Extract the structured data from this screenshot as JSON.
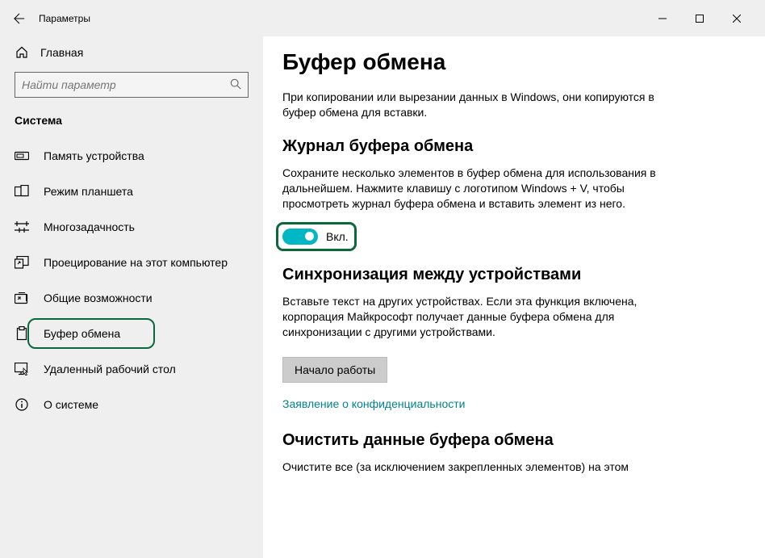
{
  "window": {
    "title": "Параметры"
  },
  "sidebar": {
    "home": "Главная",
    "search_placeholder": "Найти параметр",
    "category": "Система",
    "items": [
      {
        "label": "Память устройства"
      },
      {
        "label": "Режим планшета"
      },
      {
        "label": "Многозадачность"
      },
      {
        "label": "Проецирование на этот компьютер"
      },
      {
        "label": "Общие возможности"
      },
      {
        "label": "Буфер обмена"
      },
      {
        "label": "Удаленный рабочий стол"
      },
      {
        "label": "О системе"
      }
    ]
  },
  "page": {
    "title": "Буфер обмена",
    "intro": "При копировании или вырезании данных в Windows, они копируются в буфер обмена для вставки.",
    "history": {
      "title": "Журнал буфера обмена",
      "description": "Сохраните несколько элементов в буфер обмена для использования в дальнейшем. Нажмите клавишу с логотипом Windows + V, чтобы просмотреть журнал буфера обмена и вставить элемент из него.",
      "toggle_state": "Вкл."
    },
    "sync": {
      "title": "Синхронизация между устройствами",
      "description": "Вставьте текст на других устройствах. Если эта функция включена, корпорация Майкрософт получает данные буфера обмена для синхронизации с другими устройствами.",
      "button": "Начало работы",
      "privacy_link": "Заявление о конфиденциальности"
    },
    "clear": {
      "title": "Очистить данные буфера обмена",
      "description": "Очистите все (за исключением закрепленных элементов) на этом"
    }
  }
}
